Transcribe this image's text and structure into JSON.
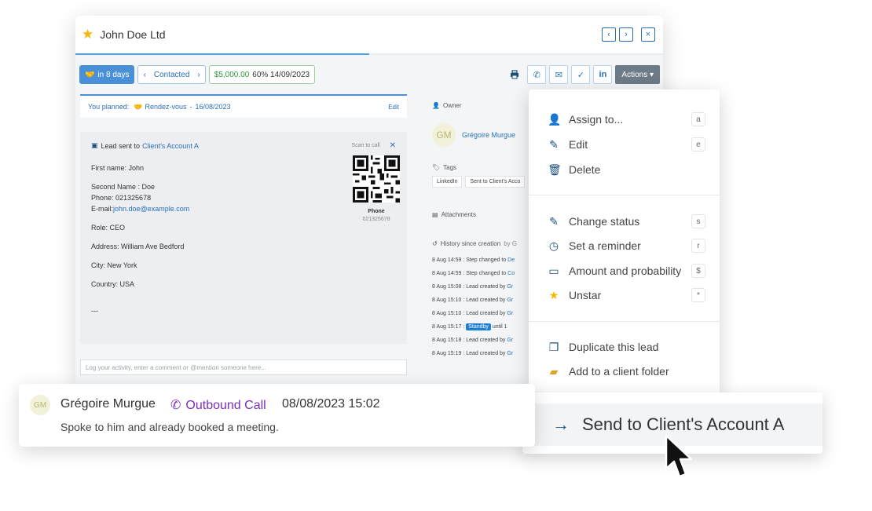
{
  "window": {
    "title": "John Doe Ltd",
    "nav": {
      "prev": "‹",
      "next": "›",
      "close": "×"
    },
    "progress_percent": 50
  },
  "toolbar": {
    "in_days": "in 8 days",
    "status": "Contacted",
    "amount": "$5,000.00",
    "probability_date": "60% 14/09/2023",
    "actions_label": "Actions ▾"
  },
  "planned": {
    "label": "You planned:",
    "event": "Rendez-vous",
    "date": "16/08/2023",
    "edit": "Edit"
  },
  "lead_card": {
    "sent_prefix": "Lead sent to",
    "sent_target": "Client's Account A",
    "scan": "Scan to call",
    "first_name": "First name: John",
    "second_name": "Second Name : Doe",
    "phone": "Phone: 021325678",
    "email_label": "E-mail:",
    "email": "john.doe@example.com",
    "role": "Role: CEO",
    "address": "Address: William Ave Bedford",
    "city": "City: New York",
    "country": "Country: USA",
    "sep": "---",
    "qr_label": "Phone",
    "qr_number": "021325678"
  },
  "log_placeholder": "Log your activity, enter a comment or @mention someone here...",
  "right": {
    "owner_title": "Owner",
    "owner_initials": "GM",
    "owner_name": "Grégoire Murgue",
    "tags_title": "Tags",
    "tags": [
      "LinkedIn",
      "Sent to Client's Acco"
    ],
    "attachments_title": "Attachments",
    "history_title": "History since creation",
    "history_by": "by G",
    "history": [
      {
        "time": "8 Aug 14:59 :",
        "text": "Step changed to",
        "link": "De"
      },
      {
        "time": "8 Aug 14:59 :",
        "text": "Step changed to",
        "link": "Co"
      },
      {
        "time": "8 Aug 15:08 :",
        "text": "Lead created by",
        "link": "Gr"
      },
      {
        "time": "8 Aug 15:10 :",
        "text": "Lead created by",
        "link": "Gr"
      },
      {
        "time": "8 Aug 15:10 :",
        "text": "Lead created by",
        "link": "Gr"
      },
      {
        "time": "8 Aug 15:17 :",
        "text": "",
        "badge": "Standby",
        "tail": "until 1"
      },
      {
        "time": "8 Aug 15:18 :",
        "text": "Lead created by",
        "link": "Gr"
      },
      {
        "time": "8 Aug 15:19 :",
        "text": "Lead created by",
        "link": "Gr"
      }
    ]
  },
  "menu": {
    "group1": [
      {
        "label": "Assign to...",
        "key": "a",
        "icon": "user-icon"
      },
      {
        "label": "Edit",
        "key": "e",
        "icon": "edit-icon"
      },
      {
        "label": "Delete",
        "key": "",
        "icon": "trash-icon"
      }
    ],
    "group2": [
      {
        "label": "Change status",
        "key": "s",
        "icon": "edit-icon"
      },
      {
        "label": "Set a reminder",
        "key": "r",
        "icon": "clock-icon"
      },
      {
        "label": "Amount and probability",
        "key": "$",
        "icon": "money-icon"
      },
      {
        "label": "Unstar",
        "key": "*",
        "icon": "star-icon"
      }
    ],
    "group3": [
      {
        "label": "Duplicate this lead",
        "icon": "copy-icon"
      },
      {
        "label": "Add to a client folder",
        "icon": "folder-icon"
      }
    ]
  },
  "send": {
    "label": "Send to Client's Account A"
  },
  "activity": {
    "initials": "GM",
    "name": "Grégoire Murgue",
    "type": "Outbound Call",
    "datetime": "08/08/2023 15:02",
    "note": "Spoke to him and already booked a meeting."
  },
  "colors": {
    "brand_blue": "#2a6fb5",
    "primary_button": "#4a90d9",
    "actions_button": "#6d7a87",
    "call_purple": "#7b2fbf",
    "amount_green": "#2e9a3d",
    "star_yellow": "#f7b500"
  }
}
